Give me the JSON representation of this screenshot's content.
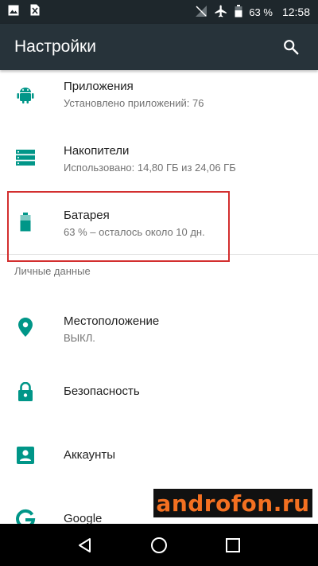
{
  "status_bar": {
    "battery_percent": "63 %",
    "time": "12:58",
    "icons": [
      "image-icon",
      "sim-card-off-icon",
      "no-signal-icon",
      "airplane-icon",
      "battery-icon"
    ]
  },
  "app_bar": {
    "title": "Настройки",
    "search_icon": "search-icon"
  },
  "settings": {
    "apps": {
      "title": "Приложения",
      "summary": "Установлено приложений: 76",
      "icon": "android-icon"
    },
    "storage": {
      "title": "Накопители",
      "summary": "Использовано: 14,80 ГБ из 24,06 ГБ",
      "icon": "storage-icon"
    },
    "battery": {
      "title": "Батарея",
      "summary": "63 % – осталось около 10 дн.",
      "icon": "battery-icon"
    },
    "personal_header": "Личные данные",
    "location": {
      "title": "Местоположение",
      "summary": "ВЫКЛ.",
      "icon": "location-pin-icon"
    },
    "security": {
      "title": "Безопасность",
      "icon": "lock-icon"
    },
    "accounts": {
      "title": "Аккаунты",
      "icon": "account-box-icon"
    },
    "google": {
      "title": "Google",
      "icon": "google-g-icon"
    }
  },
  "watermark": "androfon.ru",
  "nav_bar": {
    "icons": [
      "back-icon",
      "home-icon",
      "recents-icon"
    ]
  },
  "colors": {
    "accent": "#009688",
    "status_bar": "#1e272c",
    "app_bar": "#27333a",
    "highlight": "#d32f2f"
  }
}
